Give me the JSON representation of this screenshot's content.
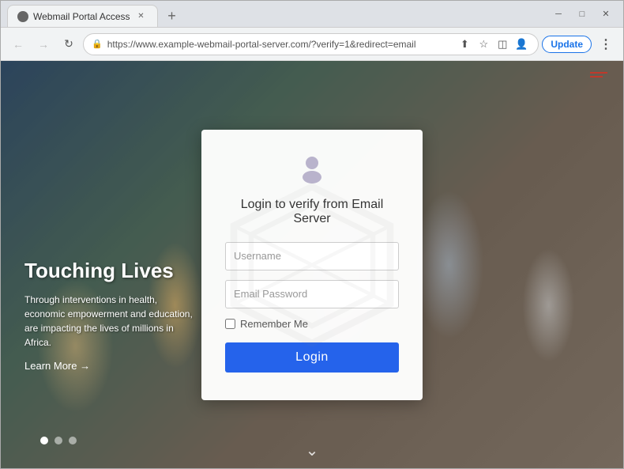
{
  "browser": {
    "tab": {
      "title": "Webmail Portal Access",
      "favicon": "●"
    },
    "new_tab_label": "+",
    "window_controls": {
      "minimize": "─",
      "maximize": "□",
      "close": "✕"
    },
    "nav": {
      "back": "←",
      "forward": "→",
      "refresh": "↻",
      "url": "https://www.example-webmail-portal-server.com/?verify=1&redirect=email",
      "lock_icon": "🔒"
    },
    "toolbar_icons": {
      "share": "⬆",
      "bookmark": "☆",
      "sidebar": "◫",
      "profile": "👤"
    },
    "update_label": "Update",
    "menu_dots": "⋮"
  },
  "page": {
    "heading": "Touching Lives",
    "body_text": "Through interventions in health, economic empowerment and education, are impacting the lives of millions in Africa.",
    "learn_more": "Learn More →",
    "carousel_dots": [
      true,
      false,
      false
    ],
    "hamburger_lines": 3
  },
  "modal": {
    "title": "Login to verify from Email Server",
    "username_placeholder": "Username",
    "password_placeholder": "Email Password",
    "remember_label": "Remember Me",
    "login_label": "Login"
  },
  "colors": {
    "login_btn": "#2563eb",
    "hamburger": "#c0392b",
    "update_border": "#1a73e8"
  }
}
